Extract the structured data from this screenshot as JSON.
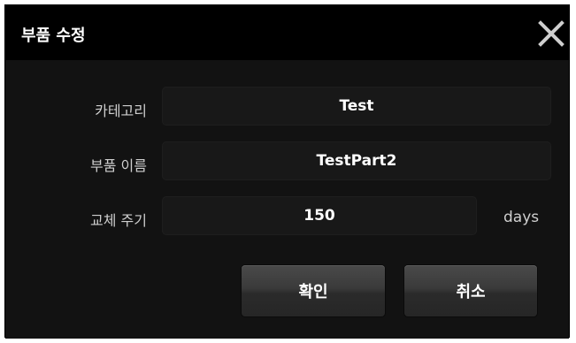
{
  "dialog": {
    "title": "부품 수정",
    "close_icon": "close-icon"
  },
  "form": {
    "category": {
      "label": "카테고리",
      "value": "Test"
    },
    "part_name": {
      "label": "부품 이름",
      "value": "TestPart2"
    },
    "replace_cycle": {
      "label": "교체 주기",
      "value": "150",
      "unit": "days"
    }
  },
  "buttons": {
    "confirm_label": "확인",
    "cancel_label": "취소"
  },
  "colors": {
    "titlebar_bg": "#000000",
    "body_bg": "#121212",
    "field_bg": "#181818",
    "text": "#ffffff",
    "label_text": "#cfcfcf"
  }
}
